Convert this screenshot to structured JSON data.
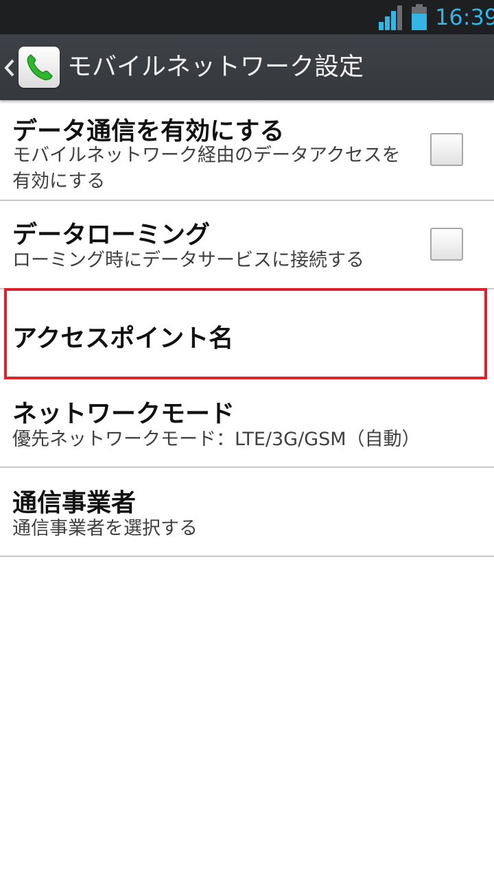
{
  "status_bar": {
    "time": "16:39",
    "icons": [
      "signal-icon",
      "battery-icon"
    ],
    "accent_color": "#33b5e5"
  },
  "action_bar": {
    "back_icon": "chevron-left-icon",
    "app_icon": "phone-icon",
    "title": "モバイルネットワーク設定"
  },
  "preferences": [
    {
      "title": "データ通信を有効にする",
      "summary": "モバイルネットワーク経由のデータアクセスを有効にする",
      "checkbox": true,
      "checked": false
    },
    {
      "title": "データローミング",
      "summary": "ローミング時にデータサービスに接続する",
      "checkbox": true,
      "checked": false
    },
    {
      "title": "アクセスポイント名",
      "highlighted": true,
      "highlight_color": "#e0202c"
    },
    {
      "title": "ネットワークモード",
      "summary": "優先ネットワークモード：LTE/3G/GSM（自動）"
    },
    {
      "title": "通信事業者",
      "summary": "通信事業者を選択する"
    }
  ]
}
